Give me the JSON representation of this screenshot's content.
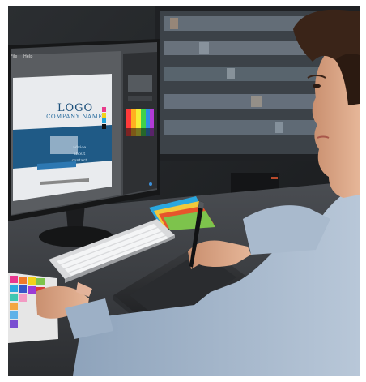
{
  "scene": {
    "screen_logo": "LOGO",
    "screen_company": "COMPANY NAME",
    "screen_menu": [
      "advice",
      "about",
      "contact"
    ],
    "app_menubar": [
      "File",
      "Help"
    ]
  },
  "colors": {
    "background": "#202326",
    "desk": "#3a3d41",
    "monitor_frame": "#1a1b1d",
    "screen_panel": "#2e3033",
    "banner_blue": "#1f5a86",
    "sleeve": "#9fb2c8",
    "skin": "#d9a485",
    "hair": "#3a2418"
  },
  "icons": [
    "keyboard",
    "pen-tablet",
    "stylus-pen",
    "color-swatch-fan",
    "color-palette-card"
  ]
}
